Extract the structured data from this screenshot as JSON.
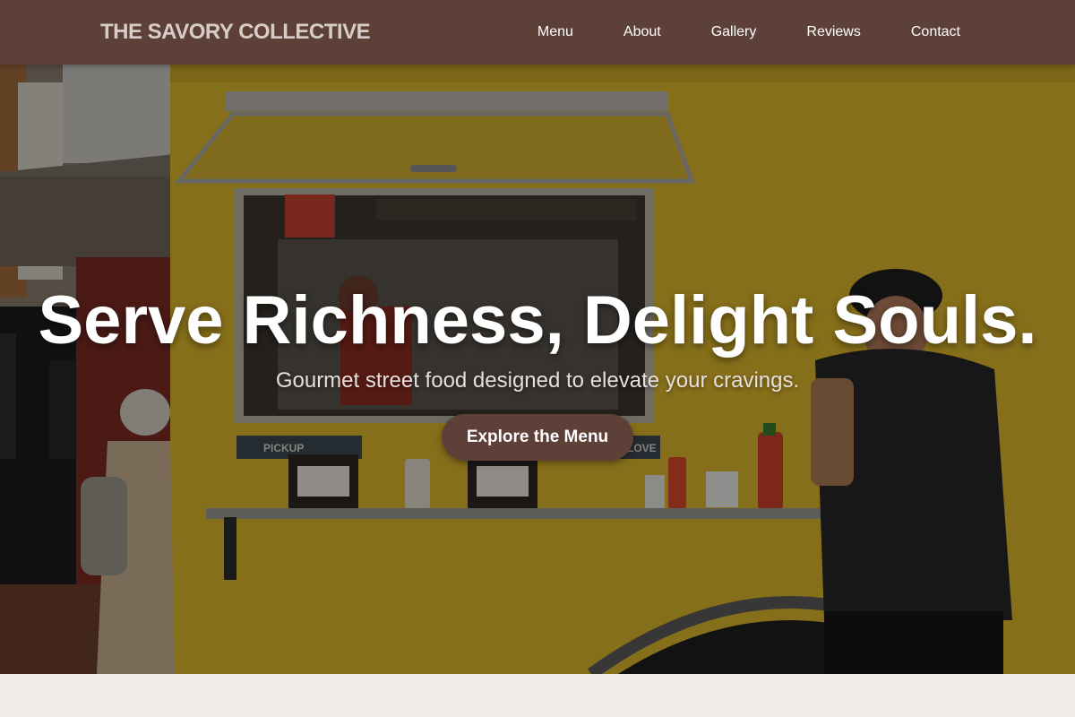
{
  "brand": {
    "name": "THE SAVORY COLLECTIVE"
  },
  "nav": {
    "links": [
      {
        "label": "Menu"
      },
      {
        "label": "About"
      },
      {
        "label": "Gallery"
      },
      {
        "label": "Reviews"
      },
      {
        "label": "Contact"
      }
    ]
  },
  "hero": {
    "title": "Serve Richness, Delight Souls.",
    "subtitle": "Gourmet street food designed to elevate your cravings.",
    "cta_label": "Explore the Menu",
    "image_signs": {
      "pickup": "PICKUP",
      "love": "LOVE"
    }
  },
  "colors": {
    "nav_bg": "#5d4037",
    "brand_text": "#d7ccc8",
    "cta_bg": "#5d4037",
    "truck_yellow": "#d9b32a",
    "page_bg": "#f2eceb"
  }
}
